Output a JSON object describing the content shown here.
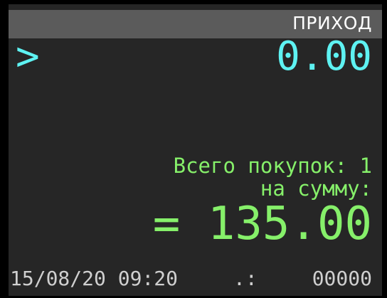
{
  "header": {
    "title": "ПРИХОД"
  },
  "input": {
    "prompt": ">",
    "value": "0.00"
  },
  "summary": {
    "purchases_label": "Всего покупок: 1",
    "amount_label": "на сумму:",
    "total": "= 135.00"
  },
  "status": {
    "datetime": "15/08/20 09:20",
    "separator": ".:",
    "counter": "00000"
  },
  "colors": {
    "background": "#262626",
    "title_bar": "#5b5b5b",
    "input": "#5ef2f2",
    "summary": "#86f06a",
    "footer": "#cfcfcf"
  }
}
